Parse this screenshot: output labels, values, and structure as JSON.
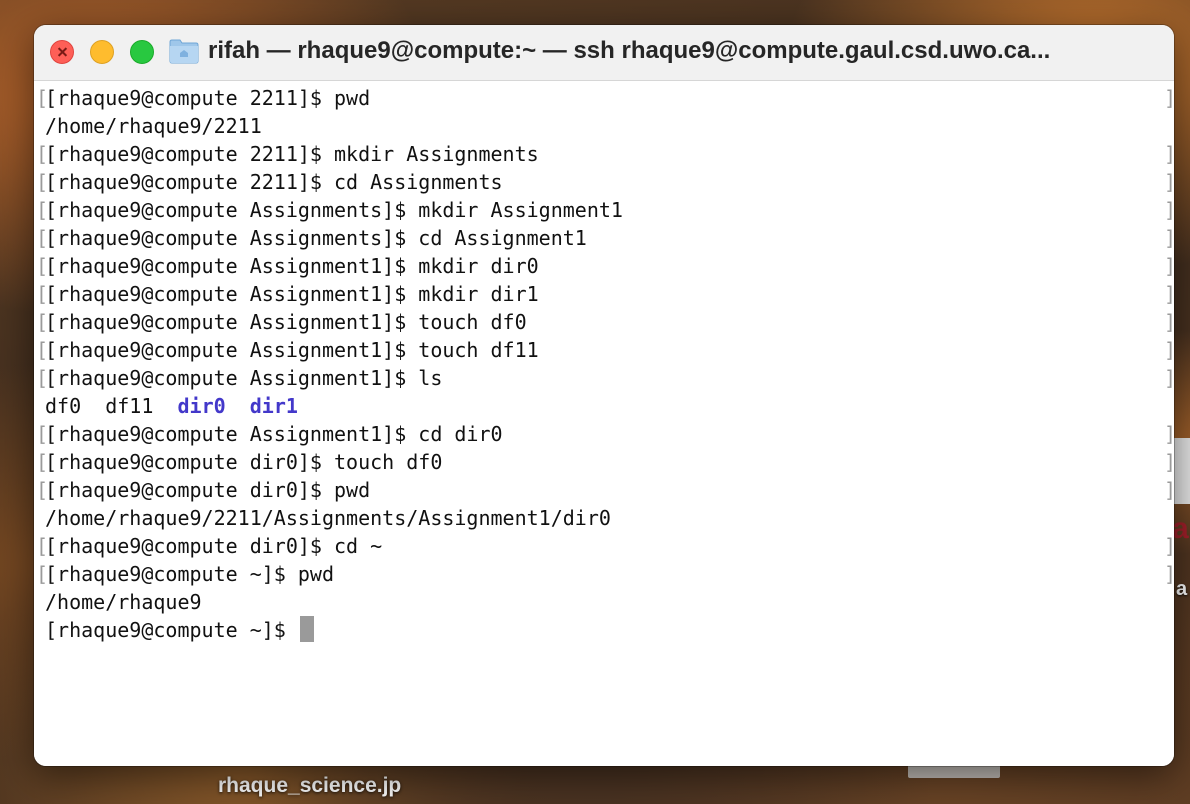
{
  "window": {
    "title": "rifah — rhaque9@compute:~ — ssh rhaque9@compute.gaul.csd.uwo.ca...",
    "icons": {
      "folder": "folder-home-icon",
      "close": "close-icon",
      "minimize": "minimize-icon",
      "zoom": "zoom-icon"
    }
  },
  "terminal": {
    "lines": [
      {
        "prefix": "[",
        "text": "[rhaque9@compute 2211]$ pwd",
        "marked": true
      },
      {
        "prefix": "",
        "text": "/home/rhaque9/2211",
        "marked": false
      },
      {
        "prefix": "[",
        "text": "[rhaque9@compute 2211]$ mkdir Assignments",
        "marked": true
      },
      {
        "prefix": "[",
        "text": "[rhaque9@compute 2211]$ cd Assignments",
        "marked": true
      },
      {
        "prefix": "[",
        "text": "[rhaque9@compute Assignments]$ mkdir Assignment1",
        "marked": true
      },
      {
        "prefix": "[",
        "text": "[rhaque9@compute Assignments]$ cd Assignment1",
        "marked": true
      },
      {
        "prefix": "[",
        "text": "[rhaque9@compute Assignment1]$ mkdir dir0",
        "marked": true
      },
      {
        "prefix": "[",
        "text": "[rhaque9@compute Assignment1]$ mkdir dir1",
        "marked": true
      },
      {
        "prefix": "[",
        "text": "[rhaque9@compute Assignment1]$ touch df0",
        "marked": true
      },
      {
        "prefix": "[",
        "text": "[rhaque9@compute Assignment1]$ touch df11",
        "marked": true
      },
      {
        "prefix": "[",
        "text": "[rhaque9@compute Assignment1]$ ls",
        "marked": true
      },
      {
        "ls_output": true
      },
      {
        "prefix": "[",
        "text": "[rhaque9@compute Assignment1]$ cd dir0",
        "marked": true
      },
      {
        "prefix": "[",
        "text": "[rhaque9@compute dir0]$ touch df0",
        "marked": true
      },
      {
        "prefix": "[",
        "text": "[rhaque9@compute dir0]$ pwd",
        "marked": true
      },
      {
        "prefix": "",
        "text": "/home/rhaque9/2211/Assignments/Assignment1/dir0",
        "marked": false
      },
      {
        "prefix": "[",
        "text": "[rhaque9@compute dir0]$ cd ~",
        "marked": true
      },
      {
        "prefix": "[",
        "text": "[rhaque9@compute ~]$ pwd",
        "marked": true
      },
      {
        "prefix": "",
        "text": "/home/rhaque9",
        "marked": false
      }
    ],
    "ls_output": {
      "files": [
        "df0",
        "df11"
      ],
      "dirs": [
        "dir0",
        "dir1"
      ]
    },
    "prompt": "[rhaque9@compute ~]$ ",
    "dir_color": "#4338ca",
    "cursor_color": "#9a9a9a",
    "mark_left": "[",
    "mark_right": "]"
  },
  "desktop": {
    "file_label": "rhaque_science.jp"
  }
}
